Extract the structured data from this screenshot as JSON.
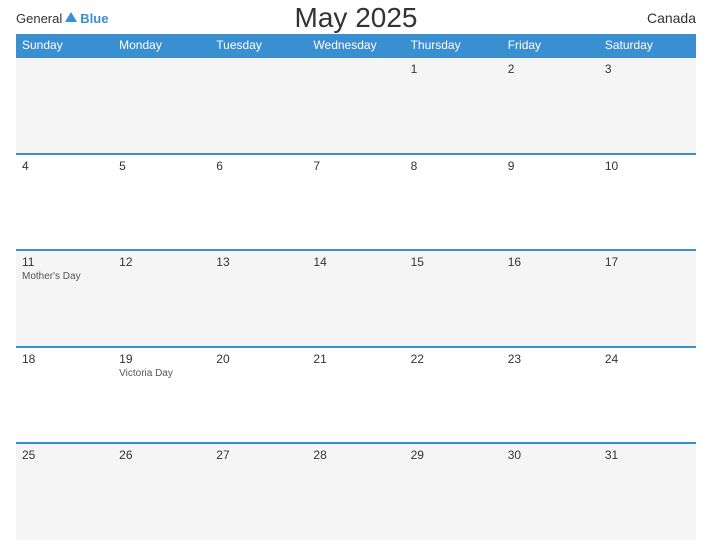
{
  "header": {
    "logo_general": "General",
    "logo_blue": "Blue",
    "month_title": "May 2025",
    "country": "Canada"
  },
  "weekdays": [
    "Sunday",
    "Monday",
    "Tuesday",
    "Wednesday",
    "Thursday",
    "Friday",
    "Saturday"
  ],
  "weeks": [
    [
      {
        "day": "",
        "event": ""
      },
      {
        "day": "",
        "event": ""
      },
      {
        "day": "",
        "event": ""
      },
      {
        "day": "",
        "event": ""
      },
      {
        "day": "1",
        "event": ""
      },
      {
        "day": "2",
        "event": ""
      },
      {
        "day": "3",
        "event": ""
      }
    ],
    [
      {
        "day": "4",
        "event": ""
      },
      {
        "day": "5",
        "event": ""
      },
      {
        "day": "6",
        "event": ""
      },
      {
        "day": "7",
        "event": ""
      },
      {
        "day": "8",
        "event": ""
      },
      {
        "day": "9",
        "event": ""
      },
      {
        "day": "10",
        "event": ""
      }
    ],
    [
      {
        "day": "11",
        "event": "Mother's Day"
      },
      {
        "day": "12",
        "event": ""
      },
      {
        "day": "13",
        "event": ""
      },
      {
        "day": "14",
        "event": ""
      },
      {
        "day": "15",
        "event": ""
      },
      {
        "day": "16",
        "event": ""
      },
      {
        "day": "17",
        "event": ""
      }
    ],
    [
      {
        "day": "18",
        "event": ""
      },
      {
        "day": "19",
        "event": "Victoria Day"
      },
      {
        "day": "20",
        "event": ""
      },
      {
        "day": "21",
        "event": ""
      },
      {
        "day": "22",
        "event": ""
      },
      {
        "day": "23",
        "event": ""
      },
      {
        "day": "24",
        "event": ""
      }
    ],
    [
      {
        "day": "25",
        "event": ""
      },
      {
        "day": "26",
        "event": ""
      },
      {
        "day": "27",
        "event": ""
      },
      {
        "day": "28",
        "event": ""
      },
      {
        "day": "29",
        "event": ""
      },
      {
        "day": "30",
        "event": ""
      },
      {
        "day": "31",
        "event": ""
      }
    ]
  ]
}
